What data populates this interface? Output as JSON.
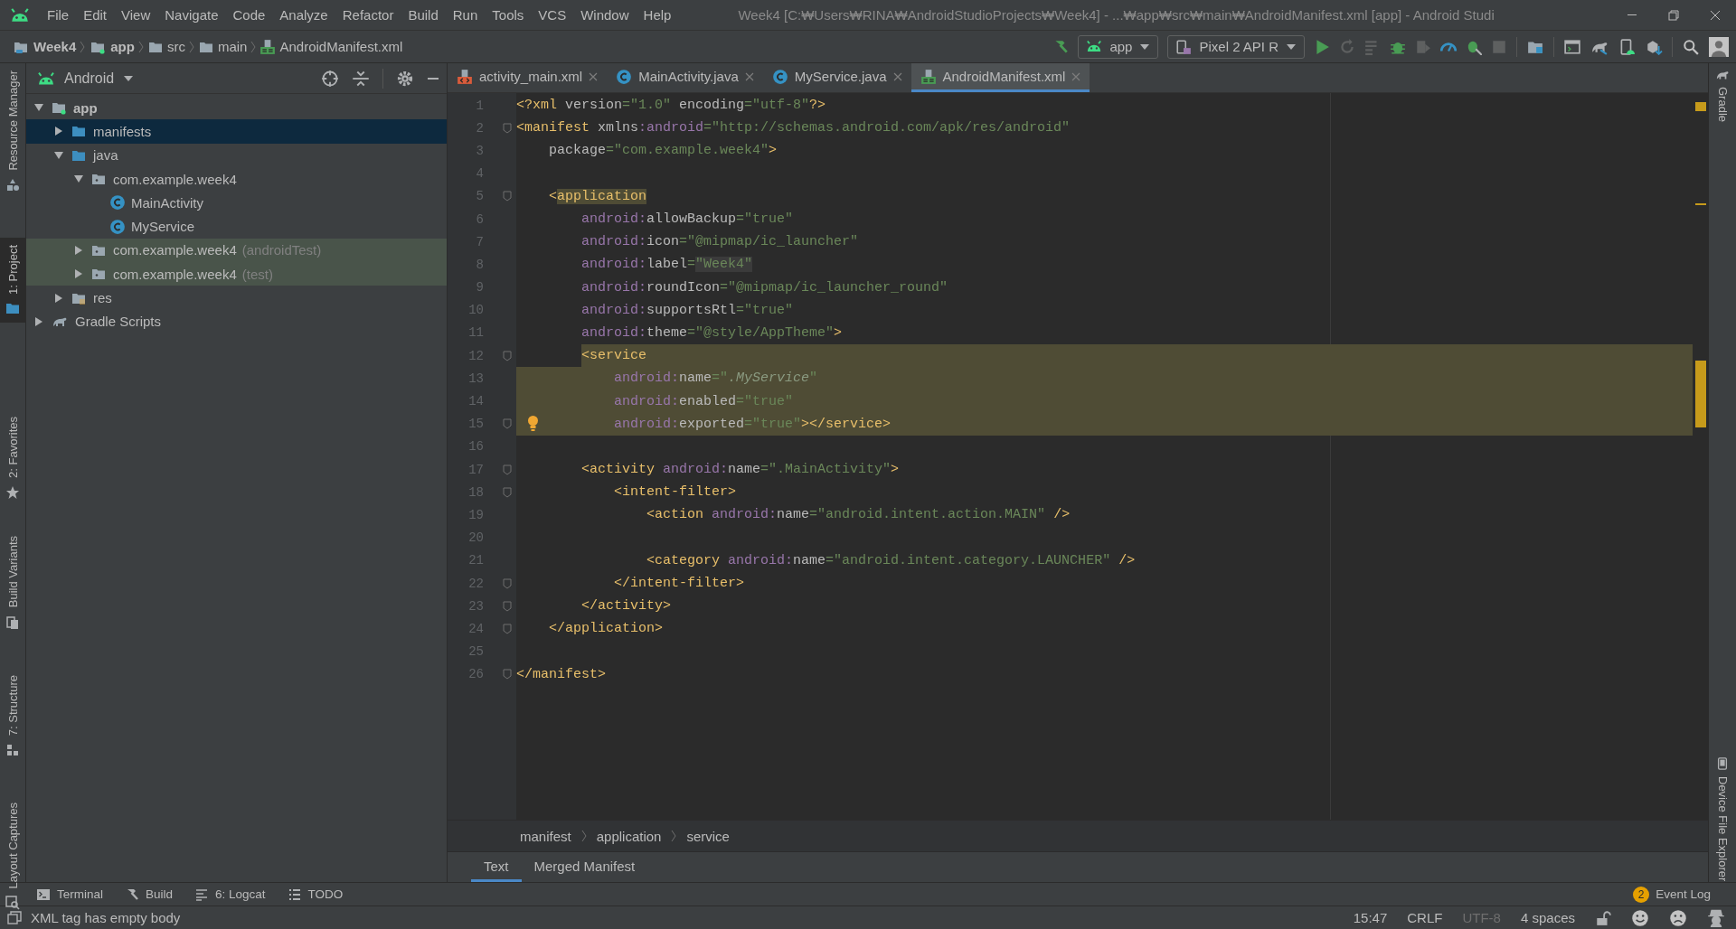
{
  "window": {
    "title": "Week4 [C:₩Users₩RINA₩AndroidStudioProjects₩Week4] - ...₩app₩src₩main₩AndroidManifest.xml [app] - Android Studi"
  },
  "menu": [
    "File",
    "Edit",
    "View",
    "Navigate",
    "Code",
    "Analyze",
    "Refactor",
    "Build",
    "Run",
    "Tools",
    "VCS",
    "Window",
    "Help"
  ],
  "nav_path": [
    {
      "label": "Week4",
      "kind": "project",
      "bold": true
    },
    {
      "label": "app",
      "kind": "module",
      "bold": true
    },
    {
      "label": "src",
      "kind": "folder",
      "bold": false
    },
    {
      "label": "main",
      "kind": "folder",
      "bold": false
    },
    {
      "label": "AndroidManifest.xml",
      "kind": "manifest",
      "bold": false
    }
  ],
  "run_config": {
    "label": "app"
  },
  "device": {
    "label": "Pixel 2 API R"
  },
  "left_tool_windows": [
    {
      "label": "Resource Manager",
      "kind": "shapes",
      "selected": false
    },
    {
      "label": "1: Project",
      "kind": "folder",
      "selected": true
    },
    {
      "label": "2: Favorites",
      "kind": "star",
      "selected": false
    },
    {
      "label": "Build Variants",
      "kind": "variants",
      "selected": false
    },
    {
      "label": "7: Structure",
      "kind": "structure",
      "selected": false
    },
    {
      "label": "Layout Captures",
      "kind": "capture",
      "selected": false
    }
  ],
  "right_tool_windows": [
    {
      "label": "Gradle",
      "kind": "elephant"
    },
    {
      "label": "Device File Explorer",
      "kind": "phone"
    }
  ],
  "project_panel": {
    "view": "Android",
    "tree": [
      {
        "label": "app",
        "kind": "module",
        "expanded": true,
        "selected": false,
        "test": false,
        "children": [
          {
            "label": "manifests",
            "kind": "folder",
            "expanded": false,
            "selected": true,
            "test": false
          },
          {
            "label": "java",
            "kind": "folder",
            "expanded": true,
            "selected": false,
            "test": false,
            "children": [
              {
                "label": "com.example.week4",
                "kind": "package",
                "expanded": true,
                "selected": false,
                "test": false,
                "children": [
                  {
                    "label": "MainActivity",
                    "kind": "class",
                    "selected": false,
                    "test": false
                  },
                  {
                    "label": "MyService",
                    "kind": "class",
                    "selected": false,
                    "test": false
                  }
                ]
              },
              {
                "label": "com.example.week4",
                "suffix": "(androidTest)",
                "kind": "package",
                "expanded": false,
                "selected": false,
                "test": true
              },
              {
                "label": "com.example.week4",
                "suffix": "(test)",
                "kind": "package",
                "expanded": false,
                "selected": false,
                "test": true
              }
            ]
          },
          {
            "label": "res",
            "kind": "res",
            "expanded": false,
            "selected": false,
            "test": false
          }
        ]
      },
      {
        "label": "Gradle Scripts",
        "kind": "gradle",
        "expanded": false,
        "selected": false,
        "test": false
      }
    ]
  },
  "editor_tabs": [
    {
      "label": "activity_main.xml",
      "kind": "layout",
      "selected": false
    },
    {
      "label": "MainActivity.java",
      "kind": "class",
      "selected": false
    },
    {
      "label": "MyService.java",
      "kind": "class",
      "selected": false
    },
    {
      "label": "AndroidManifest.xml",
      "kind": "manifest",
      "selected": true
    }
  ],
  "code_lines": [
    {
      "number": "1",
      "kind": "plain",
      "fold": false,
      "bulb": false,
      "tokens": [
        {
          "kind": "tag",
          "text": "<?xml "
        },
        {
          "kind": "attr",
          "text": "version"
        },
        {
          "kind": "value",
          "text": "=\"1.0\" "
        },
        {
          "kind": "attr",
          "text": "encoding"
        },
        {
          "kind": "value",
          "text": "=\"utf-8\""
        },
        {
          "kind": "tag",
          "text": "?>"
        }
      ]
    },
    {
      "number": "2",
      "kind": "plain",
      "fold": true,
      "bulb": false,
      "tokens": [
        {
          "kind": "tag",
          "text": "<manifest "
        },
        {
          "kind": "attr",
          "text": "xmlns"
        },
        {
          "kind": "ns",
          "text": ":android"
        },
        {
          "kind": "value",
          "text": "=\"http://schemas.android.com/apk/res/android\""
        }
      ]
    },
    {
      "number": "3",
      "kind": "plain",
      "fold": false,
      "bulb": false,
      "tokens": [
        {
          "kind": "attr",
          "text": "    package"
        },
        {
          "kind": "value",
          "text": "=\"com.example.week4\""
        },
        {
          "kind": "tag",
          "text": ">"
        }
      ]
    },
    {
      "number": "4",
      "kind": "plain",
      "fold": false,
      "bulb": false
    },
    {
      "number": "5",
      "kind": "plain",
      "fold": true,
      "bulb": false,
      "tokens": [
        {
          "kind": "tag",
          "text": "    <",
          "highlighted": false
        },
        {
          "kind": "tag",
          "text": "application",
          "highlighted": true
        }
      ]
    },
    {
      "number": "6",
      "kind": "plain",
      "fold": false,
      "bulb": false,
      "tokens": [
        {
          "kind": "ns",
          "text": "        android:"
        },
        {
          "kind": "attr",
          "text": "allowBackup"
        },
        {
          "kind": "value",
          "text": "=\"true\""
        }
      ]
    },
    {
      "number": "7",
      "kind": "plain",
      "fold": false,
      "bulb": false,
      "tokens": [
        {
          "kind": "ns",
          "text": "        android:"
        },
        {
          "kind": "attr",
          "text": "icon"
        },
        {
          "kind": "value",
          "text": "=\"@mipmap/ic_launcher\""
        }
      ]
    },
    {
      "number": "8",
      "kind": "plain",
      "fold": false,
      "bulb": false,
      "tokens": [
        {
          "kind": "ns",
          "text": "        android:"
        },
        {
          "kind": "attr",
          "text": "label"
        },
        {
          "kind": "value",
          "text": "=",
          "highlighted": false
        },
        {
          "kind": "value",
          "text": "\"Week4\"",
          "highlighted": true
        }
      ]
    },
    {
      "number": "9",
      "kind": "plain",
      "fold": false,
      "bulb": false,
      "tokens": [
        {
          "kind": "ns",
          "text": "        android:"
        },
        {
          "kind": "attr",
          "text": "roundIcon"
        },
        {
          "kind": "value",
          "text": "=\"@mipmap/ic_launcher_round\""
        }
      ]
    },
    {
      "number": "10",
      "kind": "plain",
      "fold": false,
      "bulb": false,
      "tokens": [
        {
          "kind": "ns",
          "text": "        android:"
        },
        {
          "kind": "attr",
          "text": "supportsRtl"
        },
        {
          "kind": "value",
          "text": "=\"true\""
        }
      ]
    },
    {
      "number": "11",
      "kind": "plain",
      "fold": false,
      "bulb": false,
      "tokens": [
        {
          "kind": "ns",
          "text": "        android:"
        },
        {
          "kind": "attr",
          "text": "theme"
        },
        {
          "kind": "value",
          "text": "=\"@style/AppTheme\""
        },
        {
          "kind": "tag",
          "text": ">"
        }
      ]
    },
    {
      "number": "12",
      "kind": "match-start",
      "fold": true,
      "bulb": false,
      "tokens": [
        {
          "kind": "tag",
          "text": "        <service"
        }
      ]
    },
    {
      "number": "13",
      "kind": "match",
      "fold": false,
      "bulb": false,
      "tokens": [
        {
          "kind": "ns",
          "text": "            android:"
        },
        {
          "kind": "attr",
          "text": "name"
        },
        {
          "kind": "value",
          "text": "=\""
        },
        {
          "kind": "ref",
          "text": ".MyService"
        },
        {
          "kind": "value",
          "text": "\""
        }
      ]
    },
    {
      "number": "14",
      "kind": "match",
      "fold": false,
      "bulb": false,
      "tokens": [
        {
          "kind": "ns",
          "text": "            android:"
        },
        {
          "kind": "attr",
          "text": "enabled"
        },
        {
          "kind": "value",
          "text": "=\"true\""
        }
      ]
    },
    {
      "number": "15",
      "kind": "match",
      "fold": true,
      "bulb": true,
      "tokens": [
        {
          "kind": "ns",
          "text": "            android:"
        },
        {
          "kind": "attr",
          "text": "exported"
        },
        {
          "kind": "value",
          "text": "=\"true\""
        },
        {
          "kind": "tag",
          "text": "></service>"
        }
      ]
    },
    {
      "number": "16",
      "kind": "plain",
      "fold": false,
      "bulb": false
    },
    {
      "number": "17",
      "kind": "plain",
      "fold": true,
      "bulb": false,
      "tokens": [
        {
          "kind": "tag",
          "text": "        <activity "
        },
        {
          "kind": "ns",
          "text": "android:"
        },
        {
          "kind": "attr",
          "text": "name"
        },
        {
          "kind": "value",
          "text": "=\".MainActivity\""
        },
        {
          "kind": "tag",
          "text": ">"
        }
      ]
    },
    {
      "number": "18",
      "kind": "plain",
      "fold": true,
      "bulb": false,
      "tokens": [
        {
          "kind": "tag",
          "text": "            <intent-filter>"
        }
      ]
    },
    {
      "number": "19",
      "kind": "plain",
      "fold": false,
      "bulb": false,
      "tokens": [
        {
          "kind": "tag",
          "text": "                <action "
        },
        {
          "kind": "ns",
          "text": "android:"
        },
        {
          "kind": "attr",
          "text": "name"
        },
        {
          "kind": "value",
          "text": "=\"android.intent.action.MAIN\" "
        },
        {
          "kind": "tag",
          "text": "/>"
        }
      ]
    },
    {
      "number": "20",
      "kind": "plain",
      "fold": false,
      "bulb": false
    },
    {
      "number": "21",
      "kind": "plain",
      "fold": false,
      "bulb": false,
      "tokens": [
        {
          "kind": "tag",
          "text": "                <category "
        },
        {
          "kind": "ns",
          "text": "android:"
        },
        {
          "kind": "attr",
          "text": "name"
        },
        {
          "kind": "value",
          "text": "=\"android.intent.category.LAUNCHER\" "
        },
        {
          "kind": "tag",
          "text": "/>"
        }
      ]
    },
    {
      "number": "22",
      "kind": "plain",
      "fold": true,
      "bulb": false,
      "tokens": [
        {
          "kind": "tag",
          "text": "            </intent-filter>"
        }
      ]
    },
    {
      "number": "23",
      "kind": "plain",
      "fold": true,
      "bulb": false,
      "tokens": [
        {
          "kind": "tag",
          "text": "        </activity>"
        }
      ]
    },
    {
      "number": "24",
      "kind": "plain",
      "fold": true,
      "bulb": false,
      "tokens": [
        {
          "kind": "tag",
          "text": "    </application>"
        }
      ]
    },
    {
      "number": "25",
      "kind": "plain",
      "fold": false,
      "bulb": false
    },
    {
      "number": "26",
      "kind": "plain",
      "fold": true,
      "bulb": false,
      "tokens": [
        {
          "kind": "tag",
          "text": "</manifest>"
        }
      ]
    }
  ],
  "editor_breadcrumb": [
    "manifest",
    "application",
    "service"
  ],
  "editor_bottom_tabs": [
    {
      "label": "Text",
      "selected": true
    },
    {
      "label": "Merged Manifest",
      "selected": false
    }
  ],
  "bottom_tool_windows": [
    {
      "label": "Terminal",
      "kind": "terminal"
    },
    {
      "label": "Build",
      "kind": "hammer"
    },
    {
      "label": "6: Logcat",
      "kind": "logcat"
    },
    {
      "label": "TODO",
      "kind": "list"
    }
  ],
  "event_log": {
    "label": "Event Log",
    "badge": "2"
  },
  "status_bar": {
    "message": "XML tag has empty body",
    "items": [
      {
        "text": "15:47",
        "dimmed": false
      },
      {
        "text": "CRLF",
        "dimmed": false
      },
      {
        "text": "UTF-8",
        "dimmed": true
      },
      {
        "text": "4 spaces",
        "dimmed": false
      }
    ]
  }
}
